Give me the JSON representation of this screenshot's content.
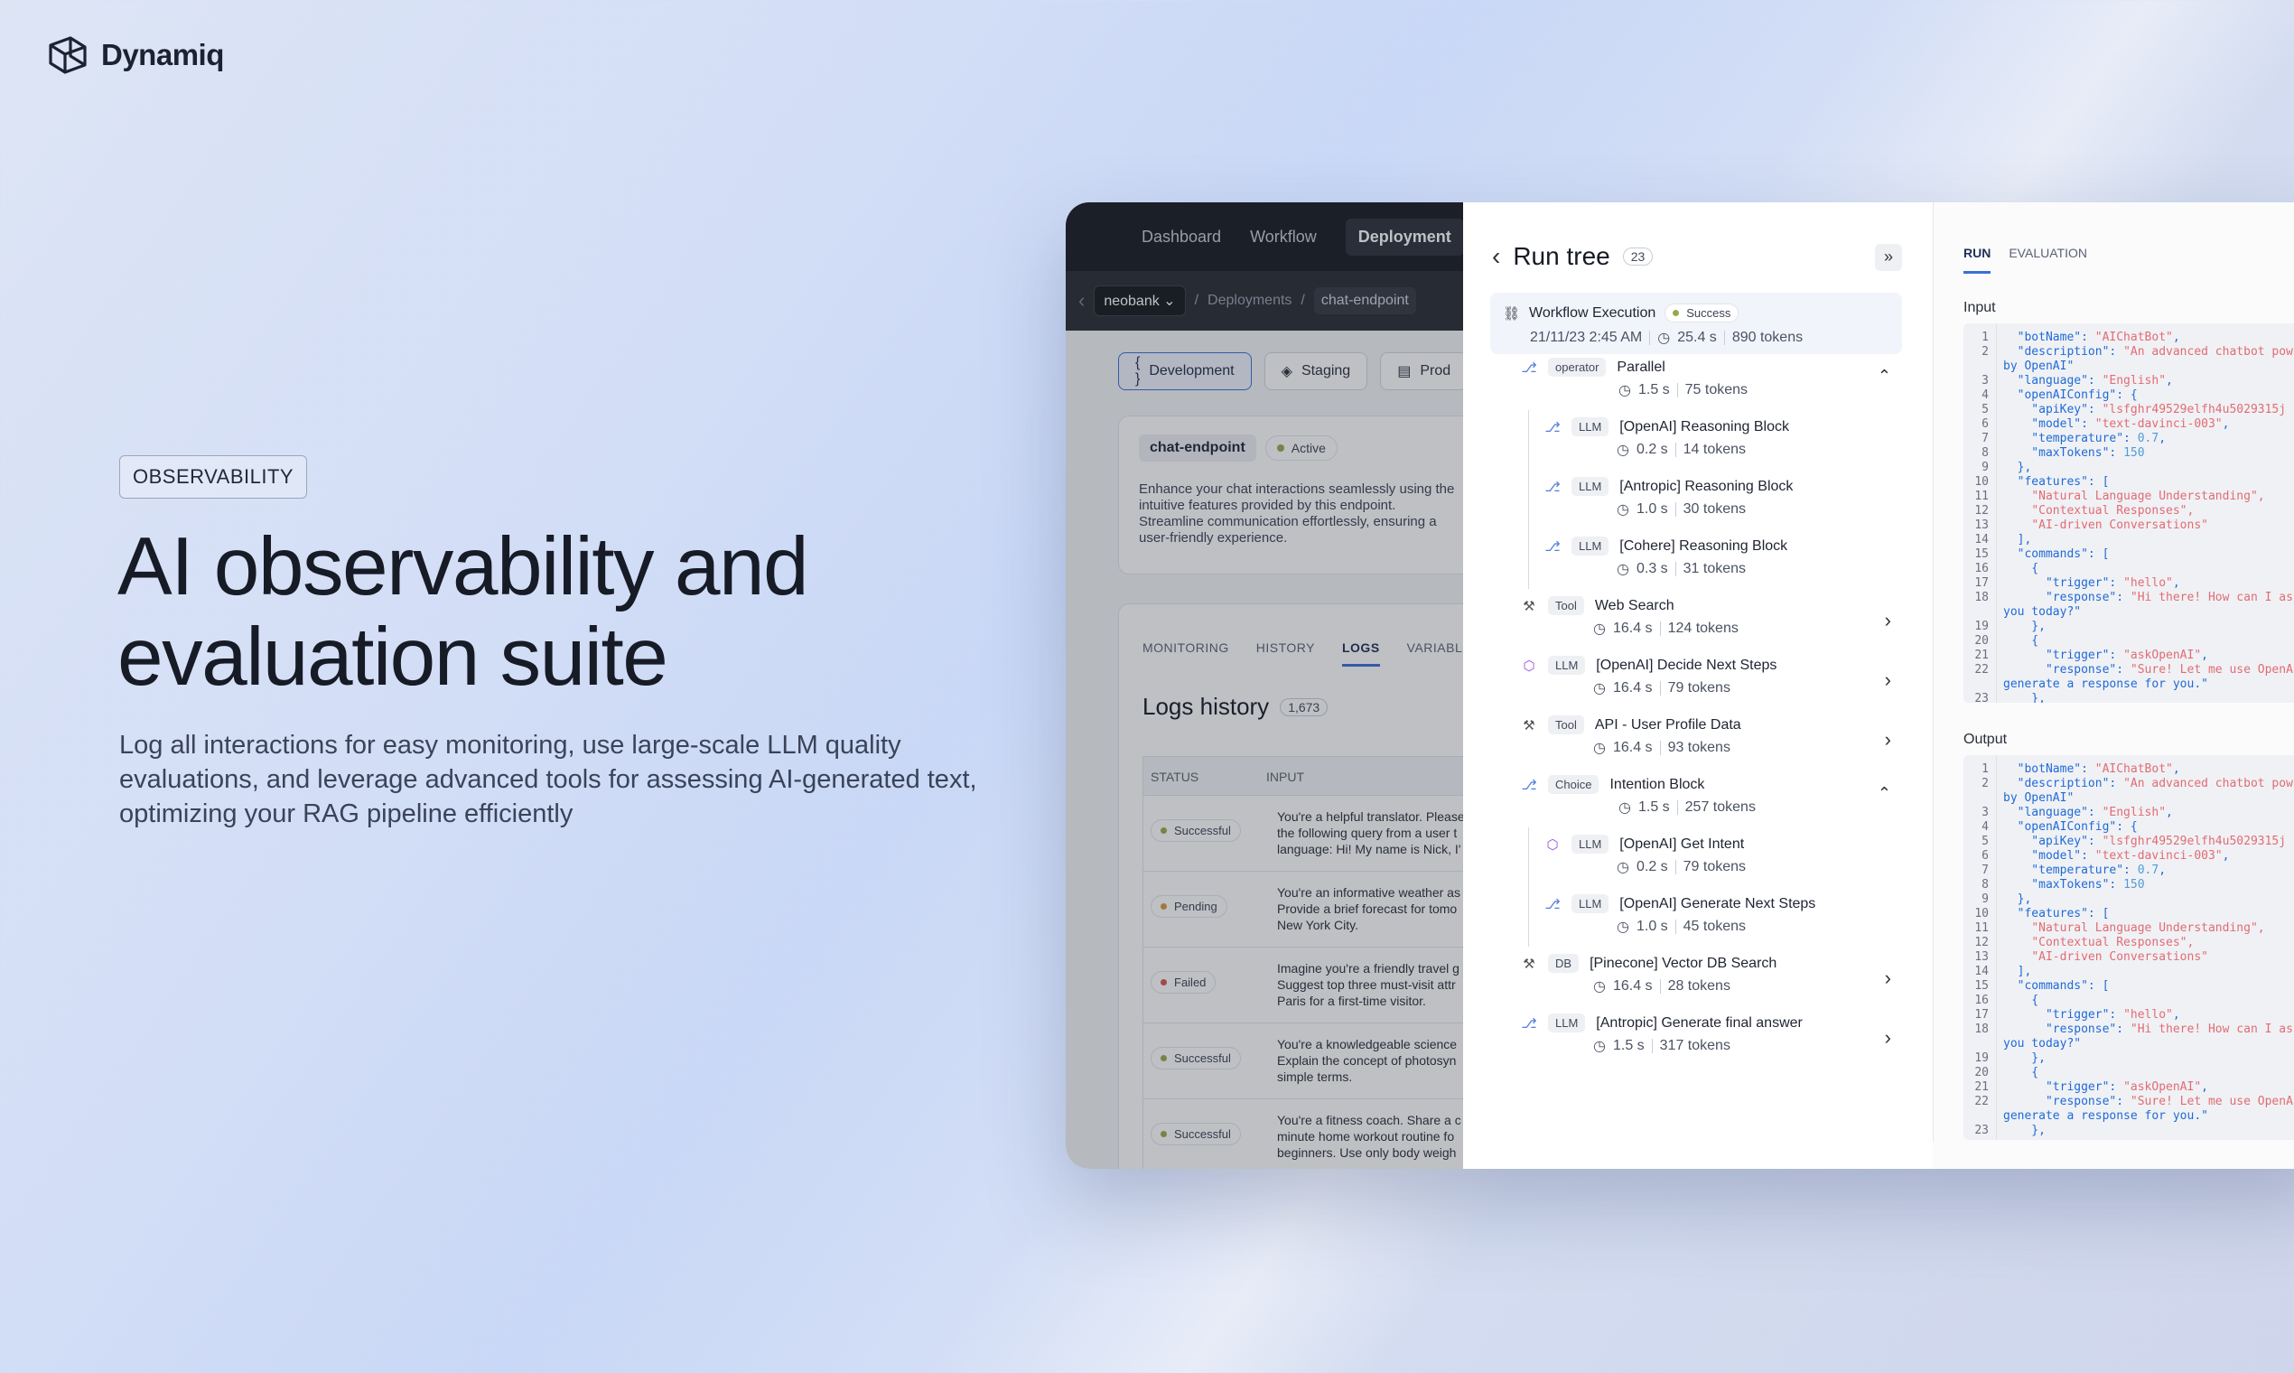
{
  "brand": {
    "name": "Dynamiq"
  },
  "hero": {
    "tag": "OBSERVABILITY",
    "title_line1": "AI observability and",
    "title_line2": "evaluation suite",
    "subtitle": "Log all interactions for easy monitoring, use large-scale LLM quality evaluations, and leverage advanced tools for assessing AI-generated text, optimizing your RAG pipeline efficiently"
  },
  "nav": {
    "items": [
      "Dashboard",
      "Workflow",
      "Deployment"
    ]
  },
  "breadcrumb": {
    "org": "neobank",
    "section": "Deployments",
    "page": "chat-endpoint",
    "sep": "/"
  },
  "env_tabs": [
    "Development",
    "Staging",
    "Prod"
  ],
  "endpoint": {
    "name": "chat-endpoint",
    "status": "Active",
    "description": "Enhance your chat interactions seamlessly using the intuitive features provided by this endpoint. Streamline communication effortlessly, ensuring a user-friendly experience."
  },
  "log_tabs": [
    "MONITORING",
    "HISTORY",
    "LOGS",
    "VARIABLES"
  ],
  "logs": {
    "title": "Logs history",
    "count": "1,673",
    "col_status": "STATUS",
    "col_input": "INPUT",
    "rows": [
      {
        "status": "Successful",
        "color": "#9aa84d",
        "lines": [
          "You're a helpful translator. Please",
          "the following query from a user t",
          "language: Hi! My name is Nick, I'"
        ]
      },
      {
        "status": "Pending",
        "color": "#d89b3c",
        "lines": [
          "You're an informative weather as",
          "Provide a brief forecast for tomo",
          "New York City."
        ]
      },
      {
        "status": "Failed",
        "color": "#d9534f",
        "lines": [
          "Imagine you're a friendly travel g",
          "Suggest top three must-visit attr",
          "Paris for a first-time visitor."
        ]
      },
      {
        "status": "Successful",
        "color": "#9aa84d",
        "lines": [
          "You're a knowledgeable science",
          "Explain the concept of photosyn",
          "simple terms."
        ]
      },
      {
        "status": "Successful",
        "color": "#9aa84d",
        "lines": [
          "You're a fitness coach. Share a c",
          "minute home workout routine fo",
          "beginners. Use only body weigh"
        ]
      }
    ]
  },
  "run_tree": {
    "title": "Run tree",
    "count": "23",
    "root": {
      "name": "Workflow Execution",
      "status": "Success",
      "date": "21/11/23 2:45 AM",
      "time": "25.4 s",
      "tokens": "890 tokens"
    },
    "nodes": [
      {
        "indent": 0,
        "badge": "operator",
        "name": "Parallel",
        "time": "1.5 s",
        "tokens": "75 tokens",
        "chev": "up",
        "icon": "flow"
      },
      {
        "indent": 1,
        "badge": "LLM",
        "name": "[OpenAI] Reasoning Block",
        "time": "0.2 s",
        "tokens": "14 tokens",
        "chev": "",
        "icon": "flow"
      },
      {
        "indent": 1,
        "badge": "LLM",
        "name": "[Antropic] Reasoning Block",
        "time": "1.0 s",
        "tokens": "30 tokens",
        "chev": "",
        "icon": "flow"
      },
      {
        "indent": 1,
        "badge": "LLM",
        "name": "[Cohere] Reasoning Block",
        "time": "0.3 s",
        "tokens": "31 tokens",
        "chev": "",
        "icon": "flow"
      },
      {
        "indent": 0,
        "badge": "Tool",
        "name": "Web Search",
        "time": "16.4 s",
        "tokens": "124 tokens",
        "chev": "right",
        "icon": "tool"
      },
      {
        "indent": 0,
        "badge": "LLM",
        "name": "[OpenAI] Decide Next Steps",
        "time": "16.4 s",
        "tokens": "79 tokens",
        "chev": "right",
        "icon": "cube"
      },
      {
        "indent": 0,
        "badge": "Tool",
        "name": "API - User Profile Data",
        "time": "16.4 s",
        "tokens": "93 tokens",
        "chev": "right",
        "icon": "tool"
      },
      {
        "indent": 0,
        "badge": "Choice",
        "name": "Intention Block",
        "time": "1.5 s",
        "tokens": "257 tokens",
        "chev": "up",
        "icon": "flow"
      },
      {
        "indent": 1,
        "badge": "LLM",
        "name": "[OpenAI] Get Intent",
        "time": "0.2 s",
        "tokens": "79 tokens",
        "chev": "",
        "icon": "cube"
      },
      {
        "indent": 1,
        "badge": "LLM",
        "name": "[OpenAI] Generate Next Steps",
        "time": "1.0 s",
        "tokens": "45 tokens",
        "chev": "",
        "icon": "flow"
      },
      {
        "indent": 0,
        "badge": "DB",
        "name": "[Pinecone] Vector DB Search",
        "time": "16.4 s",
        "tokens": "28 tokens",
        "chev": "right",
        "icon": "tool"
      },
      {
        "indent": 0,
        "badge": "LLM",
        "name": "[Antropic] Generate final answer",
        "time": "1.5 s",
        "tokens": "317 tokens",
        "chev": "right",
        "icon": "flow"
      }
    ]
  },
  "detail": {
    "tabs": [
      "RUN",
      "EVALUATION"
    ],
    "input_label": "Input",
    "output_label": "Output",
    "code_lines": [
      "  \"botName\": \"AIChatBot\",",
      "  \"description\": \"An advanced chatbot pow",
      "by OpenAI\"",
      "  \"language\": \"English\",",
      "  \"openAIConfig\": {",
      "    \"apiKey\": \"lsfghr49529elfh4u5029315j",
      "    \"model\": \"text-davinci-003\",",
      "    \"temperature\": 0.7,",
      "    \"maxTokens\": 150",
      "  },",
      "  \"features\": [",
      "    \"Natural Language Understanding\",",
      "    \"Contextual Responses\",",
      "    \"AI-driven Conversations\"",
      "  ],",
      "  \"commands\": [",
      "    {",
      "      \"trigger\": \"hello\",",
      "      \"response\": \"Hi there! How can I as",
      "you today?\"",
      "    },",
      "    {",
      "      \"trigger\": \"askOpenAI\",",
      "      \"response\": \"Sure! Let me use OpenA",
      "generate a response for you.\"",
      "    },"
    ],
    "line_numbers": [
      "1",
      "2",
      "",
      "3",
      "4",
      "5",
      "6",
      "7",
      "8",
      "9",
      "10",
      "11",
      "12",
      "13",
      "14",
      "15",
      "16",
      "17",
      "18",
      "",
      "19",
      "20",
      "21",
      "22",
      "",
      "23"
    ]
  }
}
